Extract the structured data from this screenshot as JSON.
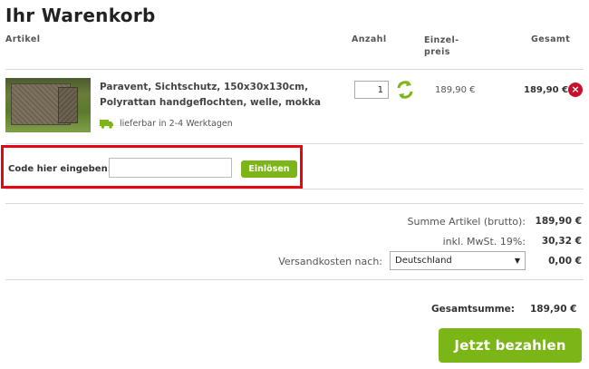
{
  "page": {
    "title": "Ihr Warenkorb"
  },
  "table_headers": {
    "artikel": "Artikel",
    "anzahl": "Anzahl",
    "einzelpreis": "Einzel-\npreis",
    "gesamt": "Gesamt"
  },
  "item": {
    "name": "Paravent, Sichtschutz, 150x30x130cm, Polyrattan handgeflochten, welle, mokka",
    "delivery": "lieferbar in 2-4 Werktagen",
    "quantity": "1",
    "unit_price": "189,90 €",
    "total": "189,90 €",
    "image_icon": "product-image",
    "remove_icon": "close-icon",
    "refresh_icon": "refresh-icon",
    "delivery_icon": "truck-icon"
  },
  "coupon": {
    "label": "Code hier eingeben:",
    "value": "",
    "button": "Einlösen"
  },
  "summary": {
    "subtotal_label": "Summe Artikel (brutto):",
    "subtotal_value": "189,90 €",
    "tax_label": "inkl. MwSt. 19%:",
    "tax_value": "30,32 €",
    "shipping_label": "Versandkosten nach:",
    "shipping_country": "Deutschland",
    "shipping_value": "0,00 €",
    "grand_total_label": "Gesamtsumme:",
    "grand_total_value": "189,90 €"
  },
  "checkout_button": "Jetzt bezahlen",
  "colors": {
    "accent_green": "#7cb518",
    "highlight_red": "#e30613",
    "remove_red": "#c8102e"
  }
}
